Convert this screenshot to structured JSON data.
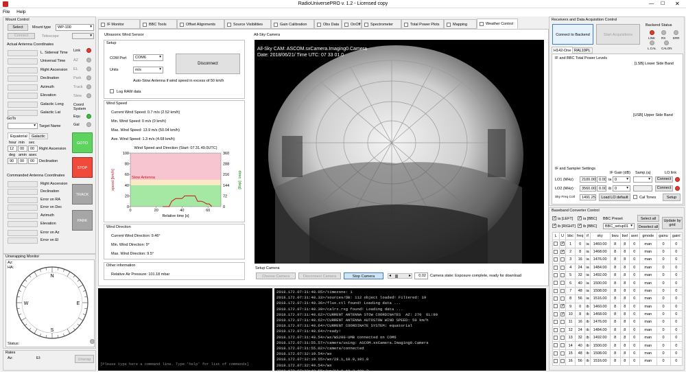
{
  "window": {
    "title": "RadioUniversePRO v. 1.2 - Licensed copy"
  },
  "menu": {
    "file": "File",
    "help": "Help"
  },
  "mount": {
    "title": "Mount Control",
    "select": "Select",
    "mount_type_label": "Mount type",
    "mount_type": "WP-100",
    "connect": "Connect",
    "telescope": "Telescope",
    "actual_title": "Actual Antenna Coordinates",
    "actual_labels": [
      "L. Sidereal Time",
      "Universal Time",
      "Right Ascension",
      "Declination",
      "Azimuth",
      "Elevation",
      "Galactic Long",
      "Galactic Lat"
    ],
    "link_labels": [
      "Link",
      "AZ",
      "EL",
      "Park",
      "Track",
      "Slew"
    ],
    "coord_system": "Coord System",
    "equ": "Equ",
    "gal": "Gal",
    "goto_title": "GoTo",
    "target_name": "Target Name",
    "tab_equatorial": "Equatorial",
    "tab_galactic": "Galactic",
    "hour": "hour",
    "min": "min",
    "sec": "sec",
    "deg": "deg",
    "amin": "amin",
    "asec": "asec",
    "ra_vals": [
      "12",
      "00",
      "00"
    ],
    "dec_vals": [
      "90",
      "00",
      "00"
    ],
    "ra_label": "Right Ascension",
    "dec_label": "Declination",
    "btn_goto": "GOTO",
    "btn_stop": "STOP",
    "btn_track": "TRACK",
    "btn_park": "PARK",
    "commanded_title": "Commanded Antenna Coordinates",
    "commanded_labels": [
      "Right Ascension",
      "Declination",
      "Error on RA",
      "Error on Dec",
      "Azimuth",
      "Elevation",
      "Error on Az",
      "Error on El"
    ]
  },
  "unwrap": {
    "title": "Unwrapping Monitor",
    "az": "Az:",
    "ha": "HA:",
    "status": "Status:",
    "n": "N",
    "s": "S",
    "e": "E",
    "w": "W"
  },
  "rates": {
    "title": "Rates",
    "az": "Az:",
    "el": "El:",
    "unwrap": "Unwrap"
  },
  "tabs": [
    "IF Monitor",
    "BBC Tools",
    "Offset Alignments",
    "Source Visibilities",
    "Gain Calibration",
    "Obs Data",
    "OnOff",
    "Spectrometer",
    "Total Power Plots",
    "Mapping",
    "Weather Control"
  ],
  "wind": {
    "title": "Ultrasonic Wind Sensor",
    "setup": "Setup",
    "com_label": "COM Port",
    "com": "COM6",
    "units_label": "Units",
    "units": "m/s",
    "disconnect": "Disconnect",
    "autostow": "Auto-Stow Antenna if wind speed in excess of 50 km/h",
    "lograw": "Log RAW data",
    "speed_title": "Wind Speed",
    "current": "Current Wind Speed: 0.7 m/s (2.52 km/h)",
    "min": "Min. Wind Speed: 0 m/s (0 km/h)",
    "max": "Max. Wind Speed: 13.9 m/s (50.04 km/h)",
    "ave": "Ave. Wind Speed: 1.3 m/s (4.68 km/h)",
    "dir_title": "Wind Direction",
    "cur_dir": "Current Wind Direction: 9.46°",
    "min_dir": "Min. Wind Direction: 0°",
    "max_dir": "Max. Wind Direction: 9.5°",
    "other_title": "Other information",
    "pressure": "Relative Air Pressure: 101.18 mbar"
  },
  "chart_data": {
    "type": "line",
    "title": "Wind Speed and Direction (Start: 07.31.49.0UTC)",
    "xlabel": "Relative time [s]",
    "ylabel": "speed [km/h]",
    "y2label": "direc. [deg]",
    "xlim": [
      0,
      70
    ],
    "ylim": [
      0,
      100
    ],
    "y2lim": [
      0,
      360
    ],
    "xticks": [
      "0",
      "20",
      "40",
      "60"
    ],
    "yticks": [
      "0",
      "20",
      "40",
      "60",
      "80",
      "100"
    ],
    "y2ticks": [
      "0",
      "72",
      "144",
      "216",
      "288",
      "360"
    ],
    "stow_label": "Stow Antenna",
    "bands": [
      {
        "from": 50,
        "to": 100,
        "color": "#f7c5cf"
      },
      {
        "from": 40,
        "to": 50,
        "color": "#fbe8c4"
      },
      {
        "from": 0,
        "to": 40,
        "color": "#a4e8a4"
      }
    ],
    "series": [
      {
        "values": [
          [
            25,
            0
          ],
          [
            30,
            0
          ],
          [
            32,
            10
          ],
          [
            35,
            15
          ],
          [
            37,
            15
          ],
          [
            40,
            15
          ],
          [
            42,
            20
          ],
          [
            44,
            20
          ],
          [
            46,
            20
          ],
          [
            50,
            20
          ],
          [
            52,
            10
          ],
          [
            55,
            10
          ],
          [
            57,
            8
          ],
          [
            59,
            5
          ],
          [
            61,
            5
          ],
          [
            63,
            0
          ]
        ],
        "color": "#cc1111"
      }
    ]
  },
  "camera": {
    "title": "All-Sky Camera",
    "overlay1": "All-Sky CAM: ASCOM.sxCamera.Imaging0.Camera",
    "overlay2": "Date: 2018/06/21/ Time UTC: 07 33 01.0",
    "setup": "Setup Camera",
    "choose": "Choose Camera",
    "disconnect": "Disconnect Camera",
    "stop": "Stop Camera",
    "exposure": "0.02",
    "state": "Camera state: Exposure complete, ready for download"
  },
  "console": {
    "lines": [
      "2018.172.07:31:48.05>/timezone: 1",
      "2018.172.07:31:48.33>/sources/DB: 112 object loaded! Filtered: 19",
      "2018.172.07:31:48.36>/flux.ctl found! Loading data ...",
      "2018.172.07:31:48.39>/calrx.rxg found! Loading data ...",
      "2018.172.07:31:48.62>/CURRENT ANTENNA STOW COORDINATES  AZ: 270  EL:90",
      "2018.172.07:31:48.62>/CURRENT ANTENNA AUTOSTOW WIND SPEED: 50 km/h",
      "2018.172.07:31:48.64>/CURRENT COORDINATE SYSTEM: equatorial",
      "2018.172.07:31:48.64>/ready!",
      "2018.172.07:31:49.54>/wx/WS200-UMB connected on COM6",
      "2018.172.07:31:55.57>/camera/using: ASCOM.sxCamera.Imaging0.Camera",
      "2018.172.07:31:55.02>/camera/connected",
      "2018.172.07:32:19.54>/wx",
      "2018.172.07:32:19.55>/wx/28.1,10.0,101.8",
      "2018.172.07:32:49.54>/wx",
      "2018.172.07:32:49.55>/wx/13.0,10.3,101.2"
    ],
    "hint": "[Please type here a command line. Type 'help' for list of commands]"
  },
  "rx": {
    "title": "Receivers and Data Acquisition Control",
    "connect": "Connect to Backend",
    "start": "Start Acquisitions",
    "backend_status": "Backend Status",
    "led_labels": [
      "LINK",
      "RX",
      "ERR",
      "L.CAL",
      "CALON"
    ],
    "tab1": "H142-One",
    "tab2": "RAL10PL",
    "if_title": "IF and BBC Total Power Levels",
    "lsb": "[LSB] Lower Side Band",
    "usb": "[USB] Upper Side Band",
    "settings": "IF and Sampler Settings",
    "if_gain": "IF Gain (dB)",
    "samp": "Samp.(a)",
    "lo_link": "LO link",
    "lo1_label": "LO1 (MHz)",
    "lo1": "2100.00",
    "lo1b": "0.00",
    "lo2_label": "LO2 (MHz)",
    "lo2": "3560.00",
    "lo2b": "0.00",
    "sky_label": "Sky Freq Coll",
    "sky": "1491.25",
    "ia": "ia",
    "ib": "ib",
    "zero": "0",
    "connect_btn": "Connect",
    "load_lo": "Load LO default",
    "cal_tones": "Cal Tones",
    "setup": "Setup",
    "baseband_title": "Baseband Converter Control",
    "ia_left": "ia [LEFT]",
    "ia_bbc": "ia [BBC]",
    "ib_right": "ib [RIGHT]",
    "ib_bbc": "ib [BBC]",
    "bbc_preset": "BBC Preset",
    "preset": "BBC_setup01",
    "select_all": "Select all",
    "deselect_all": "Deselect all",
    "update": "Update by grid",
    "cols": [
      "L",
      "U",
      "bbc",
      "freq",
      "if",
      "sky",
      "bwu",
      "bwl",
      "avei",
      "gmode",
      "gainu",
      "gainl"
    ],
    "rows": [
      [
        "1",
        "0",
        "ia",
        "1460.00",
        "8",
        "8",
        "0",
        "man",
        "0",
        "0"
      ],
      [
        "2",
        "8",
        "ia",
        "1468.00",
        "8",
        "8",
        "0",
        "man",
        "0",
        "0"
      ],
      [
        "3",
        "16",
        "ia",
        "1476.00",
        "8",
        "8",
        "0",
        "man",
        "0",
        "0"
      ],
      [
        "4",
        "24",
        "ia",
        "1484.00",
        "8",
        "8",
        "0",
        "man",
        "0",
        "0"
      ],
      [
        "5",
        "32",
        "ia",
        "1492.00",
        "8",
        "8",
        "0",
        "man",
        "0",
        "0"
      ],
      [
        "6",
        "40",
        "ia",
        "1500.00",
        "8",
        "8",
        "0",
        "man",
        "0",
        "0"
      ],
      [
        "7",
        "48",
        "ia",
        "1508.00",
        "8",
        "8",
        "0",
        "man",
        "0",
        "0"
      ],
      [
        "8",
        "56",
        "ia",
        "1516.00",
        "8",
        "8",
        "0",
        "man",
        "0",
        "0"
      ],
      [
        "9",
        "0",
        "ib",
        "1460.00",
        "8",
        "8",
        "0",
        "man",
        "0",
        "0"
      ],
      [
        "10",
        "8",
        "ib",
        "1468.00",
        "8",
        "8",
        "0",
        "man",
        "0",
        "0"
      ],
      [
        "11",
        "16",
        "ib",
        "1476.00",
        "8",
        "8",
        "0",
        "man",
        "0",
        "0"
      ],
      [
        "12",
        "24",
        "ib",
        "1484.00",
        "8",
        "8",
        "0",
        "man",
        "0",
        "0"
      ],
      [
        "13",
        "32",
        "ib",
        "1492.00",
        "8",
        "8",
        "0",
        "man",
        "0",
        "0"
      ],
      [
        "14",
        "40",
        "ib",
        "1500.00",
        "8",
        "8",
        "0",
        "man",
        "0",
        "0"
      ],
      [
        "15",
        "48",
        "ib",
        "1508.00",
        "8",
        "8",
        "0",
        "man",
        "0",
        "0"
      ],
      [
        "16",
        "56",
        "ib",
        "1516.00",
        "8",
        "8",
        "0",
        "man",
        "0",
        "0"
      ]
    ],
    "checked_U": [
      1,
      2,
      9,
      10
    ]
  }
}
